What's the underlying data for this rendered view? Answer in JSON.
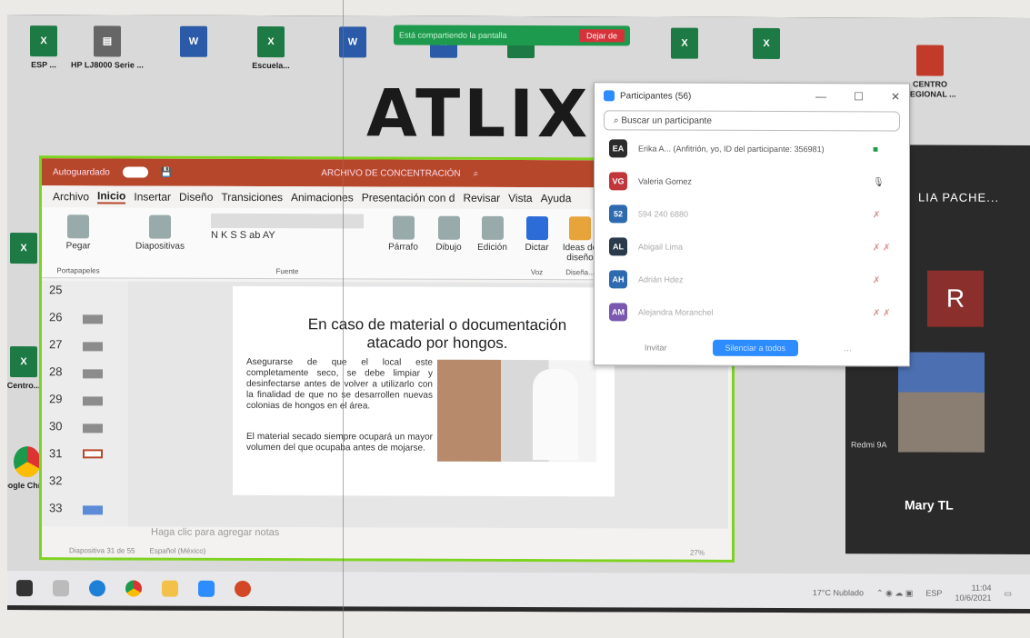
{
  "share_bar": {
    "text": "Está compartiendo la pantalla",
    "stop": "Dejar de"
  },
  "desktop": {
    "brand": "ATLIX",
    "icons": [
      "ESP ...",
      "HP LJ8000 Serie ...",
      "Escuela...",
      "Centro...",
      "Google Chrome",
      "CENTRO REGIONAL ..."
    ]
  },
  "ppt": {
    "autosave": "Autoguardado",
    "file_title": "ARCHIVO DE CONCENTRACIÓN",
    "tabs": [
      "Archivo",
      "Inicio",
      "Insertar",
      "Diseño",
      "Transiciones",
      "Animaciones",
      "Presentación con d",
      "Revisar",
      "Vista",
      "Ayuda"
    ],
    "ribbon": {
      "paste": "Pegar",
      "slides": "Diapositivas",
      "paragraph": "Párrafo",
      "drawing": "Dibujo",
      "editing": "Edición",
      "dictate": "Dictar",
      "ideas": "Ideas de diseño",
      "clipboard_group": "Portapapeles",
      "font_group": "Fuente",
      "voice_group": "Voz",
      "designer_group": "Diseña..."
    },
    "slide_numbers": [
      "25",
      "26",
      "27",
      "28",
      "29",
      "30",
      "31",
      "32",
      "33"
    ],
    "slide_title": "En caso de material o documentación atacado por hongos.",
    "bullet": "Asegurarse de que el local este completamente seco, se debe limpiar y desinfectarse antes de volver a utilizarlo con la finalidad de que no se desarrollen nuevas colonias de hongos en el área.",
    "paragraph2": "El material secado siempre ocupará un mayor volumen del que ocupaba antes de mojarse.",
    "notes_placeholder": "Haga clic para agregar notas",
    "status_slide": "Diapositiva 31 de 55",
    "status_lang": "Español (México)",
    "status_zoom": "27%"
  },
  "participants": {
    "title": "Participantes (56)",
    "search_placeholder": "Buscar un participante",
    "list": [
      {
        "initials": "EA",
        "name": "Erika A... (Anfitrión, yo, ID del participante: 356981)",
        "color": "#2b2b2b"
      },
      {
        "initials": "VG",
        "name": "Valeria Gomez",
        "color": "#c0363a"
      },
      {
        "initials": "52",
        "name": "594 240 6880",
        "color": "#2d6ab0"
      },
      {
        "initials": "AL",
        "name": "Abigail Lima",
        "color": "#2b3a4a"
      },
      {
        "initials": "AH",
        "name": "Adrián Hdez",
        "color": "#2d6ab0"
      },
      {
        "initials": "AM",
        "name": "Alejandra Moranchel",
        "color": "#7a58b0"
      }
    ],
    "invite": "Invitar",
    "mute_all": "Silenciar a todos"
  },
  "video": {
    "top_name": "LIA PACHE...",
    "r_initial": "R",
    "redmi": "Redmi 9A",
    "mary": "Mary TL"
  },
  "taskbar": {
    "weather": "17°C Nublado",
    "lang": "ESP",
    "time": "11:04",
    "date": "10/6/2021"
  }
}
